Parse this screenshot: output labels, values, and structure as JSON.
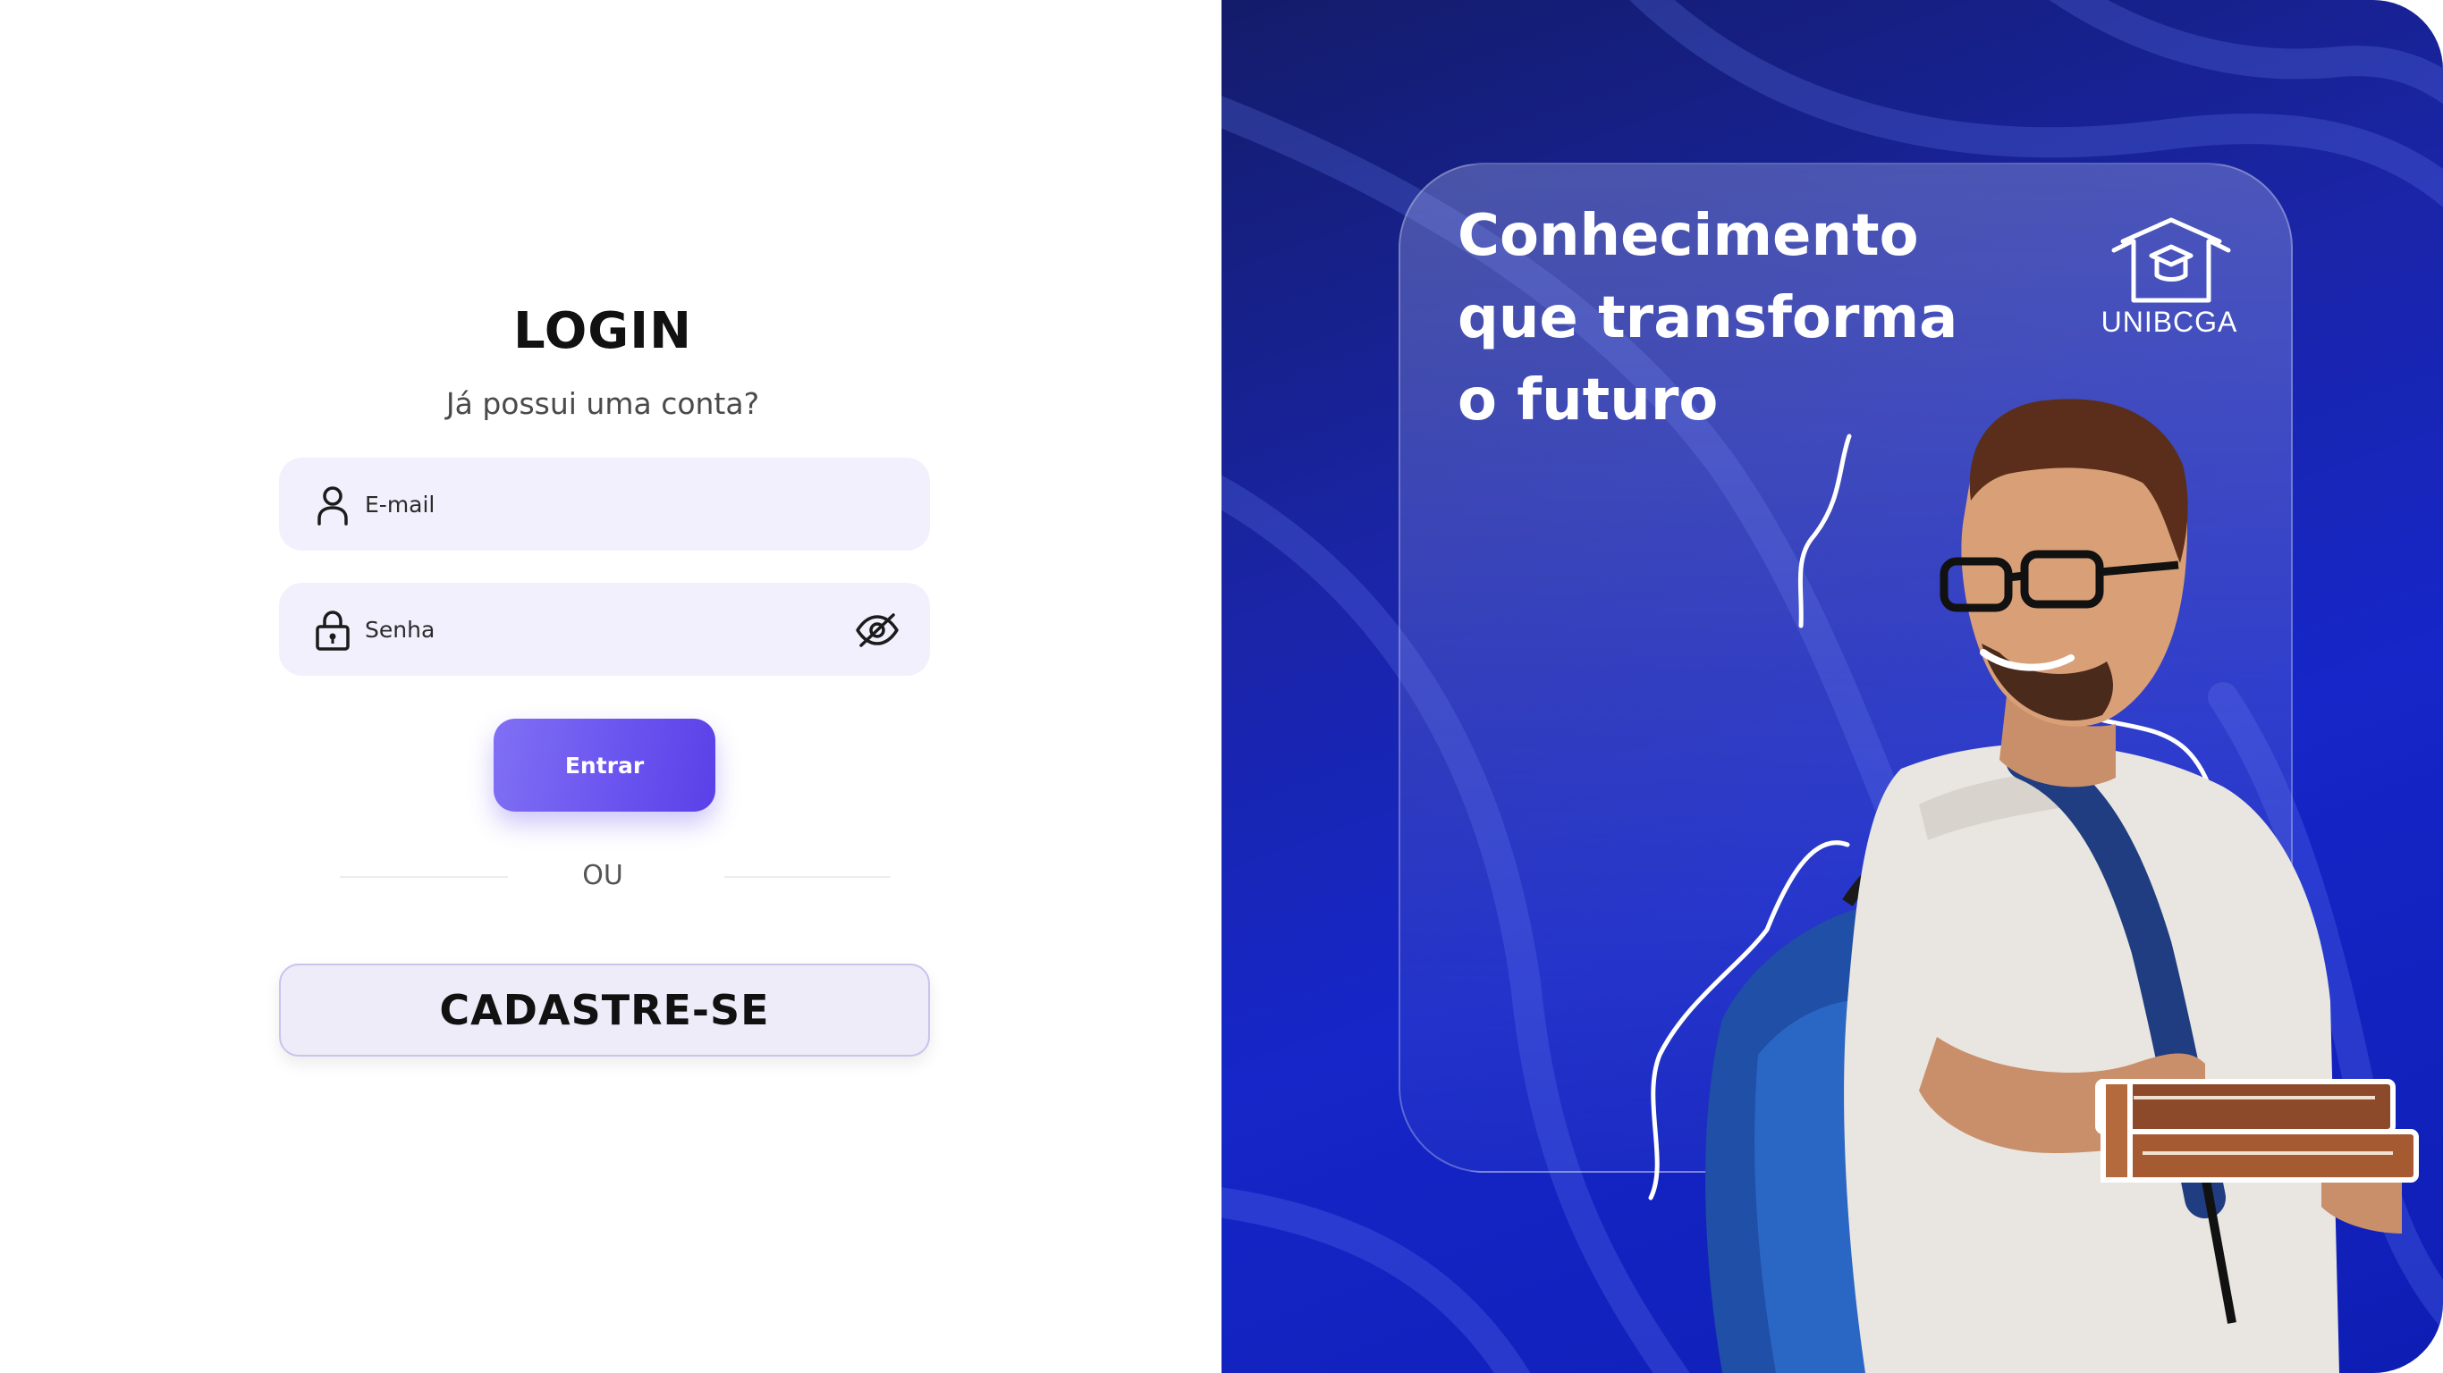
{
  "login": {
    "title": "LOGIN",
    "subtitle": "Já possui uma conta?",
    "email_placeholder": "E-mail",
    "password_placeholder": "Senha",
    "submit_label": "Entrar",
    "divider_label": "OU",
    "signup_label": "CADASTRE-SE"
  },
  "hero": {
    "headline_lines": [
      "Conhecimento",
      "que transforma",
      "o futuro"
    ],
    "brand_name": "UNIBCGA"
  },
  "icons": {
    "email": "user-icon",
    "password": "lock-icon",
    "toggle_password": "eye-off-icon",
    "brand": "graduation-box-logo"
  },
  "colors": {
    "accent": "#6a55ef",
    "field_bg": "#f2f0fd",
    "hero_bg": "#1626c8"
  }
}
